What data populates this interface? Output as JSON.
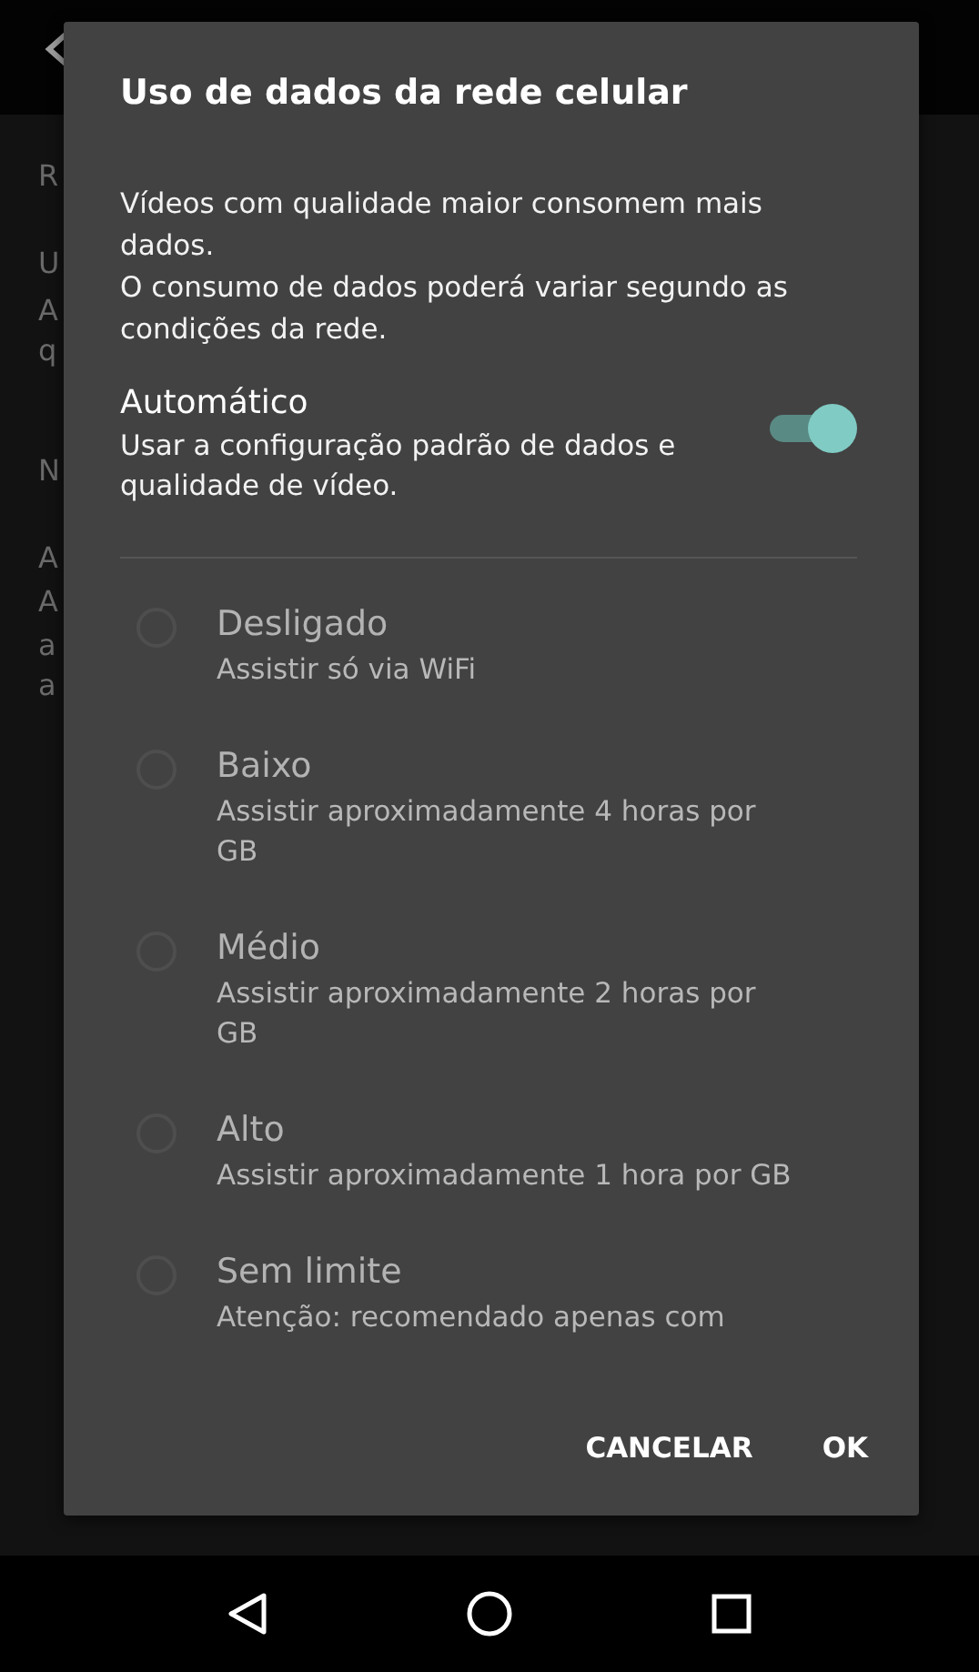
{
  "background": {
    "fragments": [
      "R",
      "U",
      "A",
      "q",
      "N",
      "A",
      "A",
      "a",
      "a"
    ]
  },
  "dialog": {
    "title": "Uso de dados da rede celular",
    "description": [
      "Vídeos com qualidade maior consomem mais dados.",
      "O consumo de dados poderá variar segundo as condições da rede."
    ],
    "auto": {
      "label": "Automático",
      "description": "Usar a configuração padrão de dados e qualidade de vídeo.",
      "on": true
    },
    "options": [
      {
        "label": "Desligado",
        "description": "Assistir só via WiFi",
        "selected": false,
        "disabled": true
      },
      {
        "label": "Baixo",
        "description": "Assistir aproximadamente 4 horas por GB",
        "selected": false,
        "disabled": true
      },
      {
        "label": "Médio",
        "description": "Assistir aproximadamente 2 horas por GB",
        "selected": false,
        "disabled": true
      },
      {
        "label": "Alto",
        "description": "Assistir aproximadamente 1 hora por GB",
        "selected": false,
        "disabled": true
      },
      {
        "label": "Sem limite",
        "description": "Atenção: recomendado apenas com",
        "selected": false,
        "disabled": true
      }
    ],
    "buttons": [
      "CANCELAR",
      "OK"
    ]
  }
}
